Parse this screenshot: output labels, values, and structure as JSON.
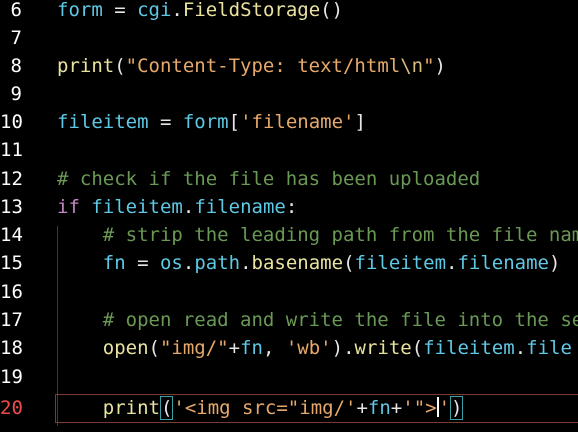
{
  "editor": {
    "colors": {
      "background": "#000000",
      "line_number": "#ffffff",
      "active_line_number": "#f14c4c",
      "keyword": "#c586c0",
      "identifier": "#5ec8e5",
      "function": "#eae3a0",
      "string": "#e6a96b",
      "comment": "#6a9955",
      "active_line_border": "#7a3a34"
    },
    "lines": [
      {
        "number": "6",
        "text": "form = cgi.FieldStorage()"
      },
      {
        "number": "7",
        "text": ""
      },
      {
        "number": "8",
        "text": "print(\"Content-Type: text/html\\n\")"
      },
      {
        "number": "9",
        "text": ""
      },
      {
        "number": "10",
        "text": "fileitem = form['filename']"
      },
      {
        "number": "11",
        "text": ""
      },
      {
        "number": "12",
        "text": "# check if the file has been uploaded"
      },
      {
        "number": "13",
        "text": "if fileitem.filename:"
      },
      {
        "number": "14",
        "text": "    # strip the leading path from the file nam"
      },
      {
        "number": "15",
        "text": "    fn = os.path.basename(fileitem.filename)"
      },
      {
        "number": "16",
        "text": ""
      },
      {
        "number": "17",
        "text": "    # open read and write the file into the se"
      },
      {
        "number": "18",
        "text": "    open(\"img/\"+fn, 'wb').write(fileitem.file"
      },
      {
        "number": "19",
        "text": ""
      },
      {
        "number": "20",
        "text": "    print('<img src=\"img/'+fn+'\">')"
      }
    ],
    "active_line": "20"
  }
}
